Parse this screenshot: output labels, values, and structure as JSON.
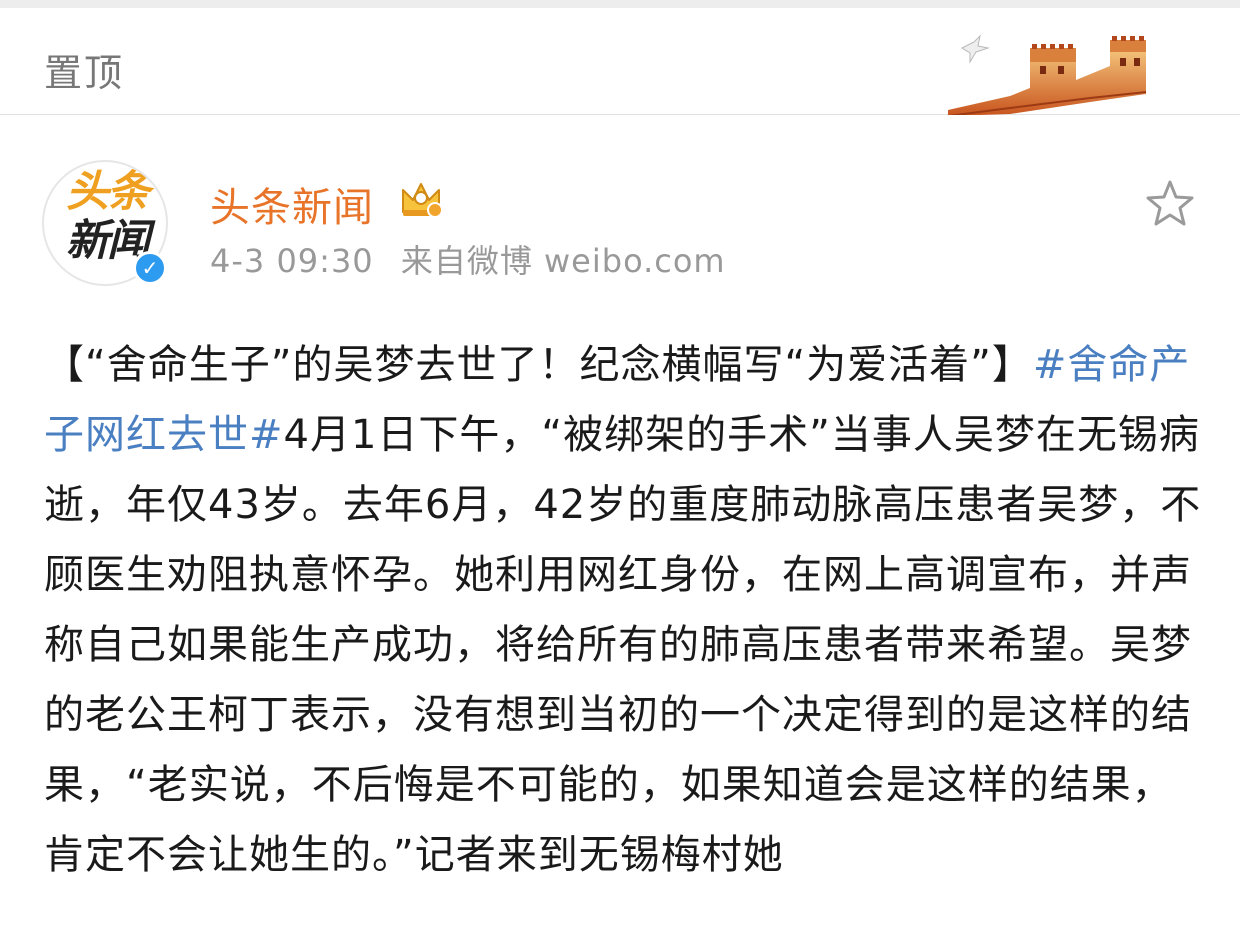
{
  "pinned": {
    "label": "置顶"
  },
  "post": {
    "author": {
      "name": "头条新闻",
      "avatar_line1": "头条",
      "avatar_line2": "新闻",
      "verified_mark": "✓"
    },
    "timestamp": "4-3 09:30",
    "source": "来自微博 weibo.com",
    "title": "【“舍命生子”的吴梦去世了！纪念横幅写“为爱活着”】",
    "hashtag": "#舍命产子网红去世#",
    "body": "4月1日下午，“被绑架的手术”当事人吴梦在无锡病逝，年仅43岁。去年6月，42岁的重度肺动脉高压患者吴梦，不顾医生劝阻执意怀孕。她利用网红身份，在网上高调宣布，并声称自己如果能生产成功，将给所有的肺高压患者带来希望。吴梦的老公王柯丁表示，没有想到当初的一个决定得到的是这样的结果，“老实说，不后悔是不可能的，如果知道会是这样的结果，肯定不会让她生的。”记者来到无锡梅村她"
  },
  "colors": {
    "username": "#e8742a",
    "hashtag": "#4a7fc1",
    "meta": "#999999",
    "verified": "#2d9bf0"
  },
  "icons": {
    "crown": "crown-icon",
    "star": "star-icon",
    "verified": "verified-icon",
    "banner": "great-wall-icon"
  }
}
